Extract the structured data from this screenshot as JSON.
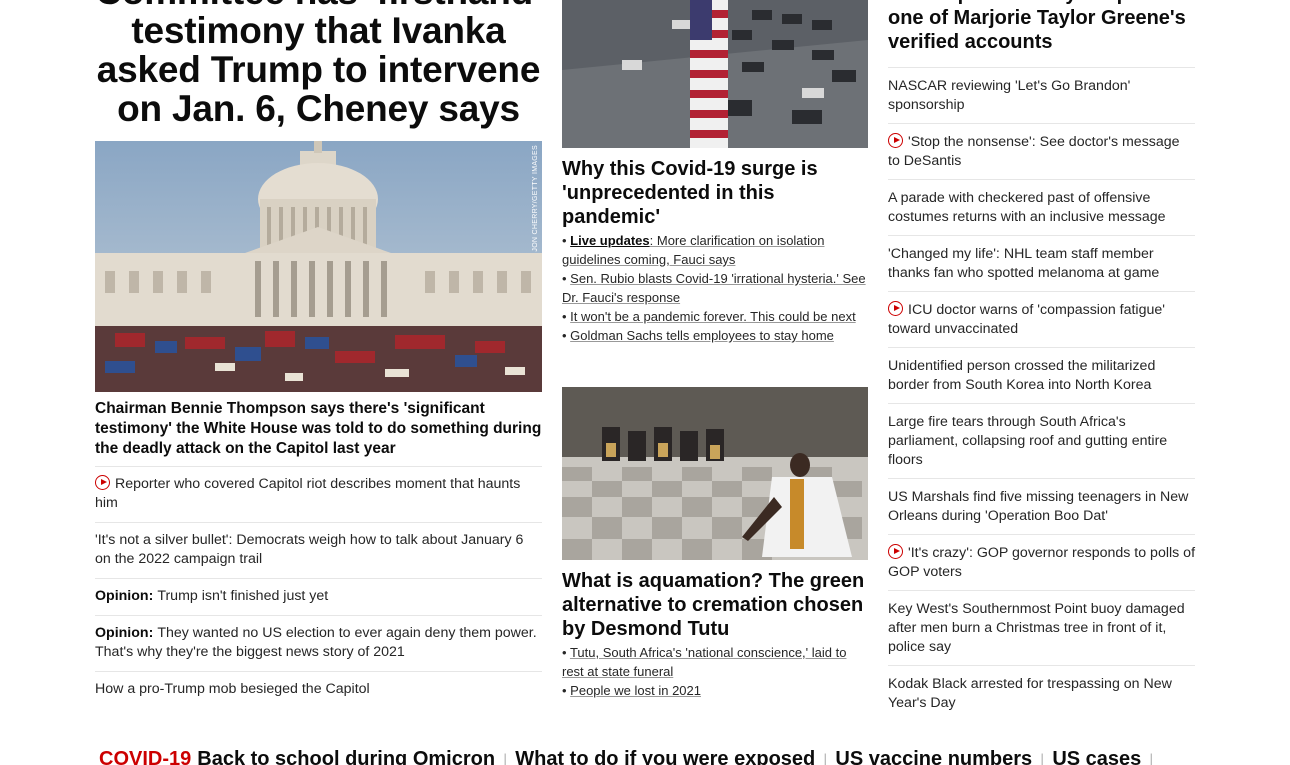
{
  "left": {
    "hero_title": "Committee has 'firsthand' testimony that Ivanka asked Trump to intervene on Jan. 6, Cheney says",
    "photo_credit": "JON CHERRY/GETTY IMAGES",
    "hero_subtitle": "Chairman Bennie Thompson says there's 'significant testimony' the White House was told to do something during the deadly attack on the Capitol last year",
    "items": [
      {
        "text": "Reporter who covered Capitol riot describes moment that haunts him",
        "video": true,
        "opinion": ""
      },
      {
        "text": "'It's not a silver bullet': Democrats weigh how to talk about January 6 on the 2022 campaign trail",
        "video": false,
        "opinion": ""
      },
      {
        "text": "Trump isn't finished just yet",
        "video": false,
        "opinion": "Opinion:"
      },
      {
        "text": "They wanted no US election to ever again deny them power. That's why they're the biggest news story of 2021",
        "video": false,
        "opinion": "Opinion:"
      },
      {
        "text": "How a pro-Trump mob besieged the Capitol",
        "video": false,
        "opinion": ""
      }
    ]
  },
  "middle": {
    "story1": {
      "title": "Why this Covid-19 surge is 'unprecedented in this pandemic'",
      "bullets": [
        {
          "label": "Live updates",
          "text": ": More clarification on isolation guidelines coming, Fauci says"
        },
        {
          "label": "",
          "text": "Sen. Rubio blasts Covid-19 'irrational hysteria.' See Dr. Fauci's response"
        },
        {
          "label": "",
          "text": "It won't be a pandemic forever. This could be next"
        },
        {
          "label": "",
          "text": "Goldman Sachs tells employees to stay home"
        }
      ]
    },
    "story2": {
      "title": "What is aquamation? The green alternative to cremation chosen by Desmond Tutu",
      "bullets": [
        {
          "label": "",
          "text": "Tutu, South Africa's 'national conscience,' laid to rest at state funeral"
        },
        {
          "label": "",
          "text": "People we lost in 2021"
        }
      ]
    }
  },
  "right": {
    "title": "Twitter permanently suspends one of Marjorie Taylor Greene's verified accounts",
    "items": [
      {
        "text": "NASCAR reviewing 'Let's Go Brandon' sponsorship",
        "video": false
      },
      {
        "text": "'Stop the nonsense': See doctor's message to DeSantis",
        "video": true
      },
      {
        "text": "A parade with checkered past of offensive costumes returns with an inclusive message",
        "video": false
      },
      {
        "text": "'Changed my life': NHL team staff member thanks fan who spotted melanoma at game",
        "video": false
      },
      {
        "text": "ICU doctor warns of 'compassion fatigue' toward unvaccinated",
        "video": true
      },
      {
        "text": "Unidentified person crossed the militarized border from South Korea into North Korea",
        "video": false
      },
      {
        "text": "Large fire tears through South Africa's parliament, collapsing roof and gutting entire floors",
        "video": false
      },
      {
        "text": "US Marshals find five missing teenagers in New Orleans during 'Operation Boo Dat'",
        "video": false
      },
      {
        "text": "'It's crazy': GOP governor responds to polls of GOP voters",
        "video": true
      },
      {
        "text": "Key West's Southernmost Point buoy damaged after men burn a Christmas tree in front of it, police say",
        "video": false
      },
      {
        "text": "Kodak Black arrested for trespassing on New Year's Day",
        "video": false
      }
    ]
  },
  "bottom": {
    "label": "COVID-19",
    "links": [
      "Back to school during Omicron",
      "What to do if you were exposed",
      "US vaccine numbers",
      "US cases"
    ]
  },
  "colors": {
    "accent": "#cc0000",
    "text": "#262626",
    "divider": "#e6e6e6"
  }
}
